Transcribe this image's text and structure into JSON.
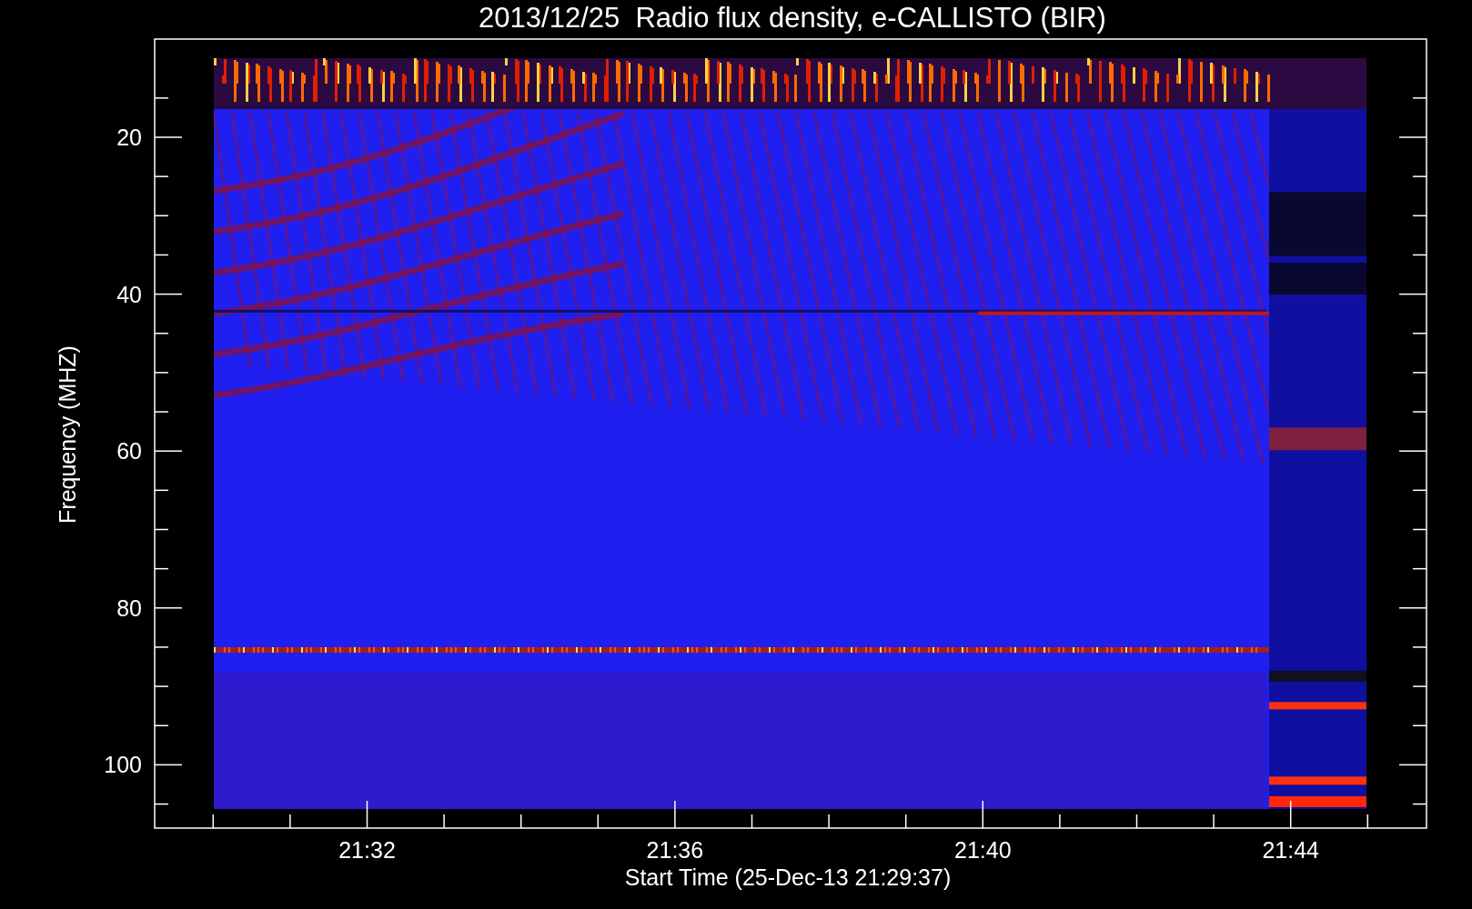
{
  "title": "2013/12/25  Radio flux density, e-CALLISTO (BIR)",
  "y_axis": {
    "label": "Frequency (MHZ)",
    "ticks": [
      "20",
      "40",
      "60",
      "80",
      "100"
    ]
  },
  "x_axis": {
    "label": "Start Time (25-Dec-13 21:29:37)",
    "ticks": [
      "21:32",
      "21:36",
      "21:40",
      "21:44"
    ]
  }
}
